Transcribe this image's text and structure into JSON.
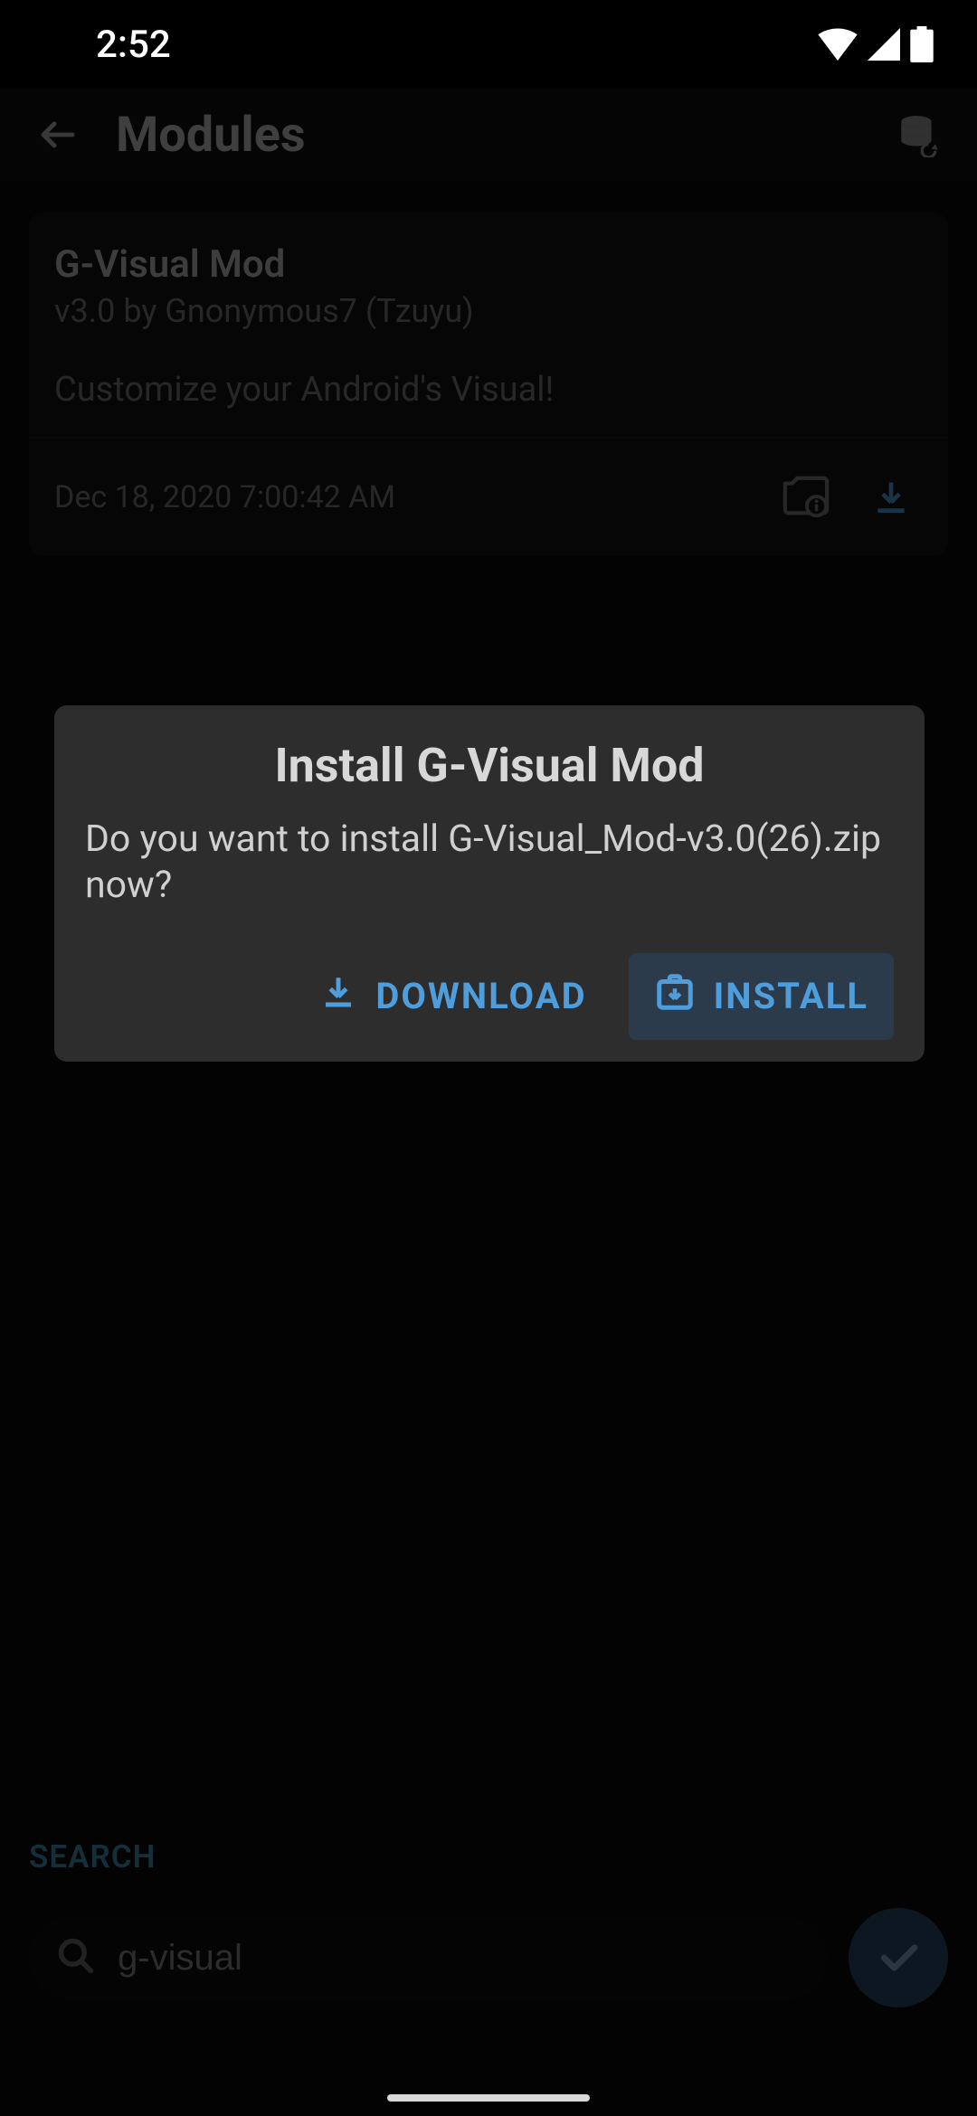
{
  "status": {
    "time": "2:52"
  },
  "header": {
    "title": "Modules"
  },
  "module": {
    "name": "G-Visual Mod",
    "version_author": "v3.0 by Gnonymous7 (Tzuyu)",
    "description": "Customize your Android's Visual!",
    "date": "Dec 18, 2020 7:00:42 AM"
  },
  "dialog": {
    "title": "Install G-Visual Mod",
    "body": "Do you want to install G-Visual_Mod-v3.0(26).zip now?",
    "download_label": "DOWNLOAD",
    "install_label": "INSTALL"
  },
  "search": {
    "label": "SEARCH",
    "value": "g-visual"
  },
  "colors": {
    "accent": "#4f9edb",
    "dialog_bg": "#2d2d2d",
    "fab_bg": "#2a496a"
  }
}
